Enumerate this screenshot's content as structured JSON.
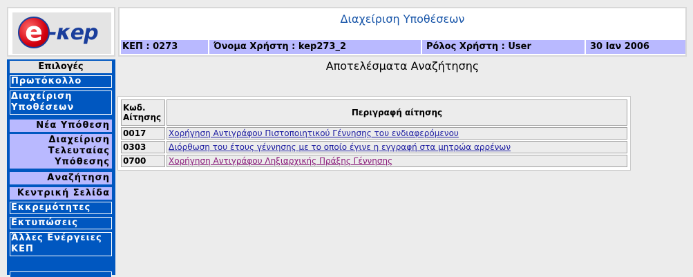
{
  "logo": {
    "letter": "e",
    "text": "-κep"
  },
  "header": {
    "title": "Διαχείριση Υποθέσεων",
    "kep": "ΚΕΠ : 0273",
    "username": "Όνομα Χρήστη : kep273_2",
    "role": "Ρόλος Χρήστη : User",
    "date": "30 Ιαν 2006"
  },
  "sidebar": {
    "header": "Επιλογές",
    "items": [
      {
        "label": "Πρωτόκολλο"
      },
      {
        "label": "Διαχείριση Υποθέσεων"
      },
      {
        "label": "Νέα Υπόθεση"
      },
      {
        "label": "Διαχείριση Τελευταίας Υπόθεσης"
      },
      {
        "label": "Αναζήτηση"
      },
      {
        "label": "Κεντρική Σελίδα"
      },
      {
        "label": "Εκκρεμότητες"
      },
      {
        "label": "Εκτυπώσεις"
      },
      {
        "label": "Άλλες Ενέργειες ΚΕΠ"
      }
    ]
  },
  "main": {
    "title": "Αποτελέσματα Αναζήτησης",
    "table": {
      "headers": {
        "code": "Κωδ. Αίτησης",
        "description": "Περιγραφή αίτησης"
      },
      "rows": [
        {
          "code": "0017",
          "description": "Χορήγηση Αντιγράφου Πιστοποιητικού Γέννησης του ενδιαφερόμενου"
        },
        {
          "code": "0303",
          "description": "Διόρθωση του έτους γέννησης με το οποίο έγινε η εγγραφή στα μητρώα αρρένων"
        },
        {
          "code": "0700",
          "description": "Χορήγηση Αντιγράφου Ληξιαρχικής Πράξης Γέννησης"
        }
      ]
    }
  },
  "colors": {
    "sidebar_blue": "#0057c0",
    "light_purple": "#b9b9ff",
    "title_blue": "#1654a8",
    "link": "#1a1aa0",
    "visited_link": "#8a1a7a"
  }
}
